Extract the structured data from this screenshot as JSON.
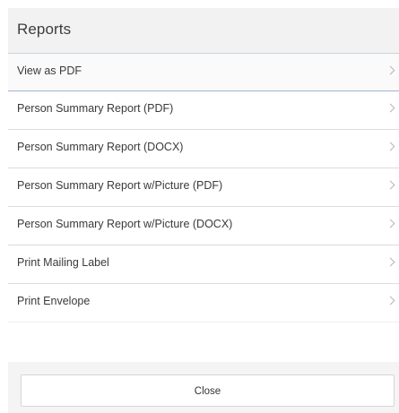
{
  "dialog": {
    "title": "Reports",
    "items": [
      {
        "label": "View as PDF"
      },
      {
        "label": "Person Summary Report (PDF)"
      },
      {
        "label": "Person Summary Report (DOCX)"
      },
      {
        "label": "Person Summary Report w/Picture (PDF)"
      },
      {
        "label": "Person Summary Report w/Picture (DOCX)"
      },
      {
        "label": "Print Mailing Label"
      },
      {
        "label": "Print Envelope"
      }
    ],
    "close_label": "Close"
  },
  "icons": {
    "item_chevron": "chevron-right-icon"
  },
  "colors": {
    "header_bg": "#f2f2f2",
    "active_divider": "#9fb4cc",
    "footer_bg": "#f4f4f4"
  }
}
